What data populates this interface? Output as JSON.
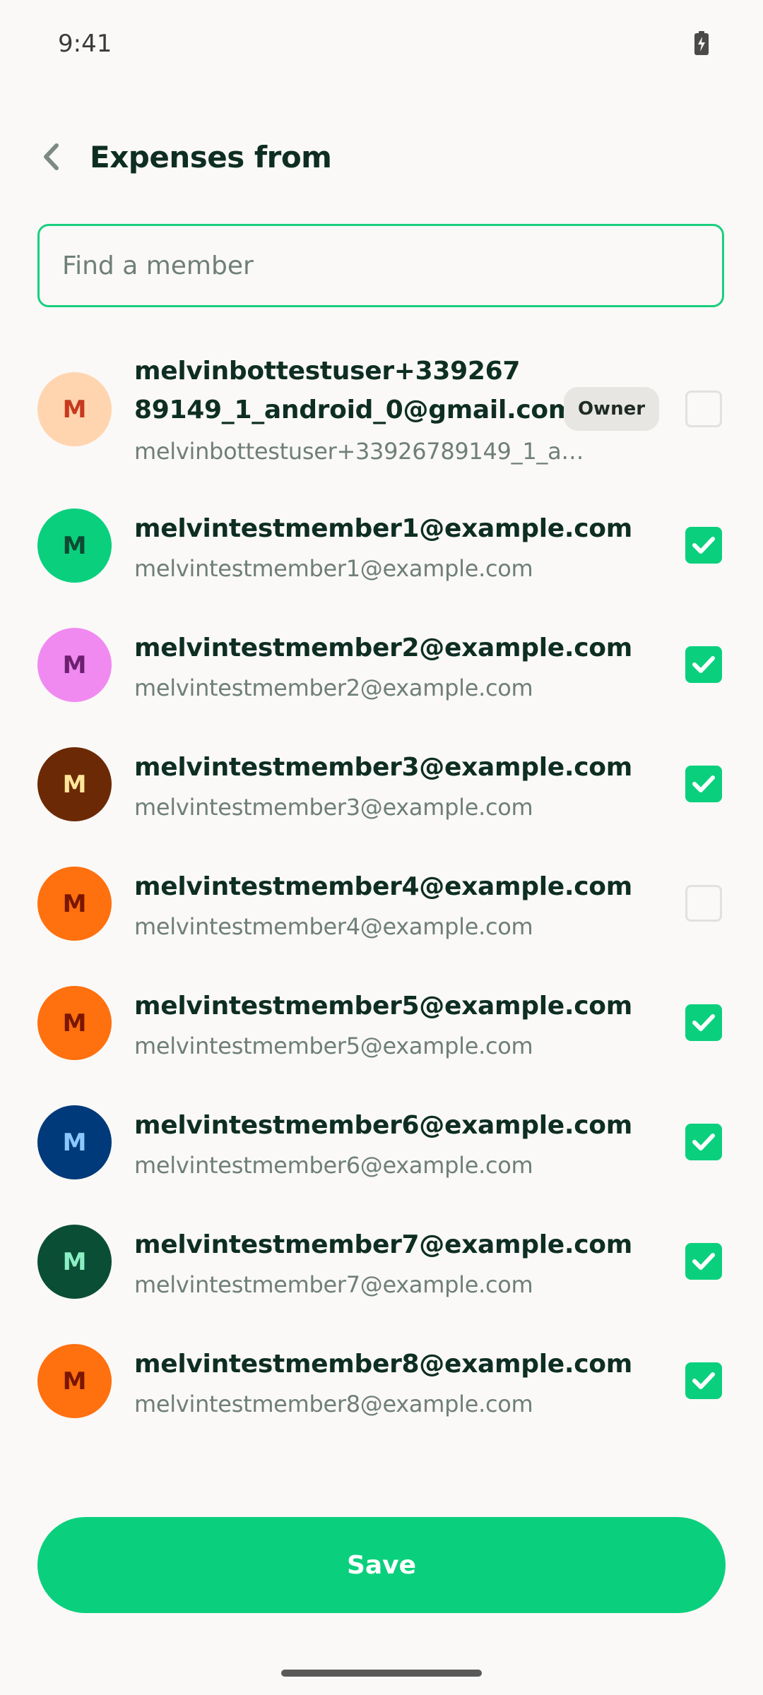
{
  "status_bar": {
    "time": "9:41",
    "battery_icon": "battery-charging-icon"
  },
  "header": {
    "back_icon": "chevron-left-icon",
    "title": "Expenses from"
  },
  "search": {
    "placeholder": "Find a member",
    "value": ""
  },
  "members": [
    {
      "initial": "M",
      "name_line1": "melvinbottestuser+339267",
      "name_line2": "89149_1_android_0@gmail.com",
      "email": "melvinbottestuser+33926789149_1_a…",
      "badge": "Owner",
      "checked": false,
      "avatar_bg": "#FFD5B0",
      "avatar_fg": "#C73A1E"
    },
    {
      "initial": "M",
      "name": "melvintestmember1@example.com",
      "email": "melvintestmember1@example.com",
      "checked": true,
      "avatar_bg": "#0AD07D",
      "avatar_fg": "#0E4A33"
    },
    {
      "initial": "M",
      "name": "melvintestmember2@example.com",
      "email": "melvintestmember2@example.com",
      "checked": true,
      "avatar_bg": "#F08AF0",
      "avatar_fg": "#6C1F6E"
    },
    {
      "initial": "M",
      "name": "melvintestmember3@example.com",
      "email": "melvintestmember3@example.com",
      "checked": true,
      "avatar_bg": "#6B2A05",
      "avatar_fg": "#FFE59A"
    },
    {
      "initial": "M",
      "name": "melvintestmember4@example.com",
      "email": "melvintestmember4@example.com",
      "checked": false,
      "avatar_bg": "#FF700F",
      "avatar_fg": "#7A1600"
    },
    {
      "initial": "M",
      "name": "melvintestmember5@example.com",
      "email": "melvintestmember5@example.com",
      "checked": true,
      "avatar_bg": "#FF700F",
      "avatar_fg": "#7A1600"
    },
    {
      "initial": "M",
      "name": "melvintestmember6@example.com",
      "email": "melvintestmember6@example.com",
      "checked": true,
      "avatar_bg": "#003A7A",
      "avatar_fg": "#8CC8FF"
    },
    {
      "initial": "M",
      "name": "melvintestmember7@example.com",
      "email": "melvintestmember7@example.com",
      "checked": true,
      "avatar_bg": "#0B4E36",
      "avatar_fg": "#8CEFC3"
    },
    {
      "initial": "M",
      "name": "melvintestmember8@example.com",
      "email": "melvintestmember8@example.com",
      "checked": true,
      "avatar_bg": "#FF700F",
      "avatar_fg": "#7A1600"
    }
  ],
  "save_label": "Save",
  "colors": {
    "accent": "#0AD07D",
    "text_primary": "#0E2E23",
    "text_secondary": "#6F7F78"
  }
}
